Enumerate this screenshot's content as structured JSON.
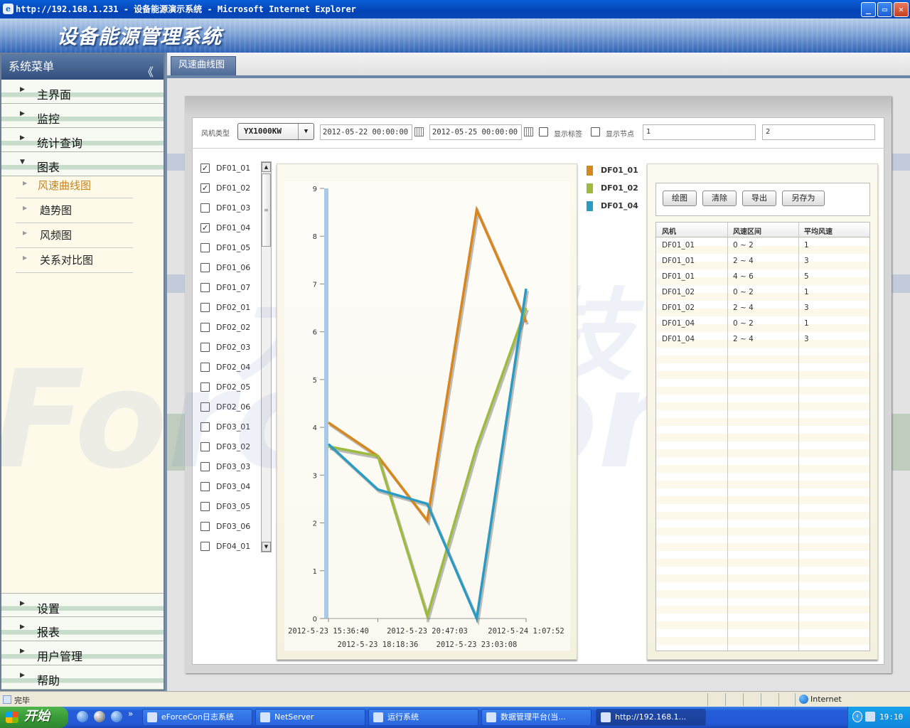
{
  "window": {
    "title": "http://192.168.1.231 - 设备能源演示系统 - Microsoft Internet Explorer",
    "ie_icon": "e",
    "minimize": "_",
    "maximize": "▭",
    "close": "✕"
  },
  "banner": {
    "title": "设备能源管理系统"
  },
  "sidebar": {
    "title": "系统菜单",
    "collapse": "《",
    "top_items": [
      {
        "label": "主界面"
      },
      {
        "label": "监控"
      },
      {
        "label": "统计查询"
      },
      {
        "label": "图表"
      }
    ],
    "sub_items": [
      {
        "label": "风速曲线图"
      },
      {
        "label": "趋势图"
      },
      {
        "label": "风频图"
      },
      {
        "label": "关系对比图"
      }
    ],
    "bottom_items": [
      {
        "label": "设置"
      },
      {
        "label": "报表"
      },
      {
        "label": "用户管理"
      },
      {
        "label": "帮助"
      }
    ]
  },
  "tab": {
    "label": "风速曲线图"
  },
  "toolbar": {
    "fan_type_label": "风机类型",
    "fan_type_value": "YX1000KW",
    "dd_arrow": "▼",
    "start_date": "2012-05-22 00:00:00",
    "end_date": "2012-05-25 00:00:00",
    "show_tag_label": "显示标签",
    "show_node_label": "显示节点",
    "field1_value": "1",
    "field2_value": "2"
  },
  "fan_list": [
    {
      "label": "DF01_01",
      "checked": true
    },
    {
      "label": "DF01_02",
      "checked": true
    },
    {
      "label": "DF01_03",
      "checked": false
    },
    {
      "label": "DF01_04",
      "checked": true
    },
    {
      "label": "DF01_05",
      "checked": false
    },
    {
      "label": "DF01_06",
      "checked": false
    },
    {
      "label": "DF01_07",
      "checked": false
    },
    {
      "label": "DF02_01",
      "checked": false
    },
    {
      "label": "DF02_02",
      "checked": false
    },
    {
      "label": "DF02_03",
      "checked": false
    },
    {
      "label": "DF02_04",
      "checked": false
    },
    {
      "label": "DF02_05",
      "checked": false
    },
    {
      "label": "DF02_06",
      "checked": false
    },
    {
      "label": "DF03_01",
      "checked": false
    },
    {
      "label": "DF03_02",
      "checked": false
    },
    {
      "label": "DF03_03",
      "checked": false
    },
    {
      "label": "DF03_04",
      "checked": false
    },
    {
      "label": "DF03_05",
      "checked": false
    },
    {
      "label": "DF03_06",
      "checked": false
    },
    {
      "label": "DF04_01",
      "checked": false
    }
  ],
  "scroll": {
    "up": "▲",
    "down": "▼",
    "grip": "≡"
  },
  "chart_data": {
    "type": "line",
    "ylim": [
      0,
      9
    ],
    "yticks": [
      "0",
      "1",
      "2",
      "3",
      "4",
      "5",
      "6",
      "7",
      "8",
      "9"
    ],
    "xticks": [
      "2012-5-23 15:36:40",
      "2012-5-23 18:18:36",
      "2012-5-23 20:47:03",
      "2012-5-23 23:03:08",
      "2012-5-24 1:07:52"
    ],
    "series": [
      {
        "name": "DF01_01",
        "color": "#d8861e",
        "values": [
          4.1,
          3.4,
          2.05,
          8.55,
          6.2
        ]
      },
      {
        "name": "DF01_02",
        "color": "#9cbb3f",
        "values": [
          3.6,
          3.4,
          0.05,
          3.6,
          6.5
        ]
      },
      {
        "name": "DF01_04",
        "color": "#2b9bc3",
        "values": [
          3.65,
          2.7,
          2.4,
          0.0,
          6.9
        ]
      }
    ]
  },
  "actions": {
    "draw": "绘图",
    "clear": "清除",
    "export": "导出",
    "save_as": "另存为"
  },
  "table": {
    "headers": [
      "风机",
      "风速区间",
      "平均风速"
    ],
    "rows": [
      [
        "DF01_01",
        "0 ~ 2",
        "1"
      ],
      [
        "DF01_01",
        "2 ~ 4",
        "3"
      ],
      [
        "DF01_01",
        "4 ~ 6",
        "5"
      ],
      [
        "DF01_02",
        "0 ~ 2",
        "1"
      ],
      [
        "DF01_02",
        "2 ~ 4",
        "3"
      ],
      [
        "DF01_04",
        "0 ~ 2",
        "1"
      ],
      [
        "DF01_04",
        "2 ~ 4",
        "3"
      ]
    ]
  },
  "watermark": {
    "cn": "力控科技",
    "en": "ForceCon"
  },
  "statusbar": {
    "text": "完毕",
    "zone": "Internet"
  },
  "taskbar": {
    "start": "开始",
    "quick_more": "»",
    "buttons": [
      {
        "label": "eForceCon日志系统"
      },
      {
        "label": "NetServer"
      },
      {
        "label": "运行系统"
      },
      {
        "label": "数据管理平台(当..."
      },
      {
        "label": "http://192.168.1..."
      }
    ],
    "time": "19:10",
    "tray_arrow": "‹"
  }
}
